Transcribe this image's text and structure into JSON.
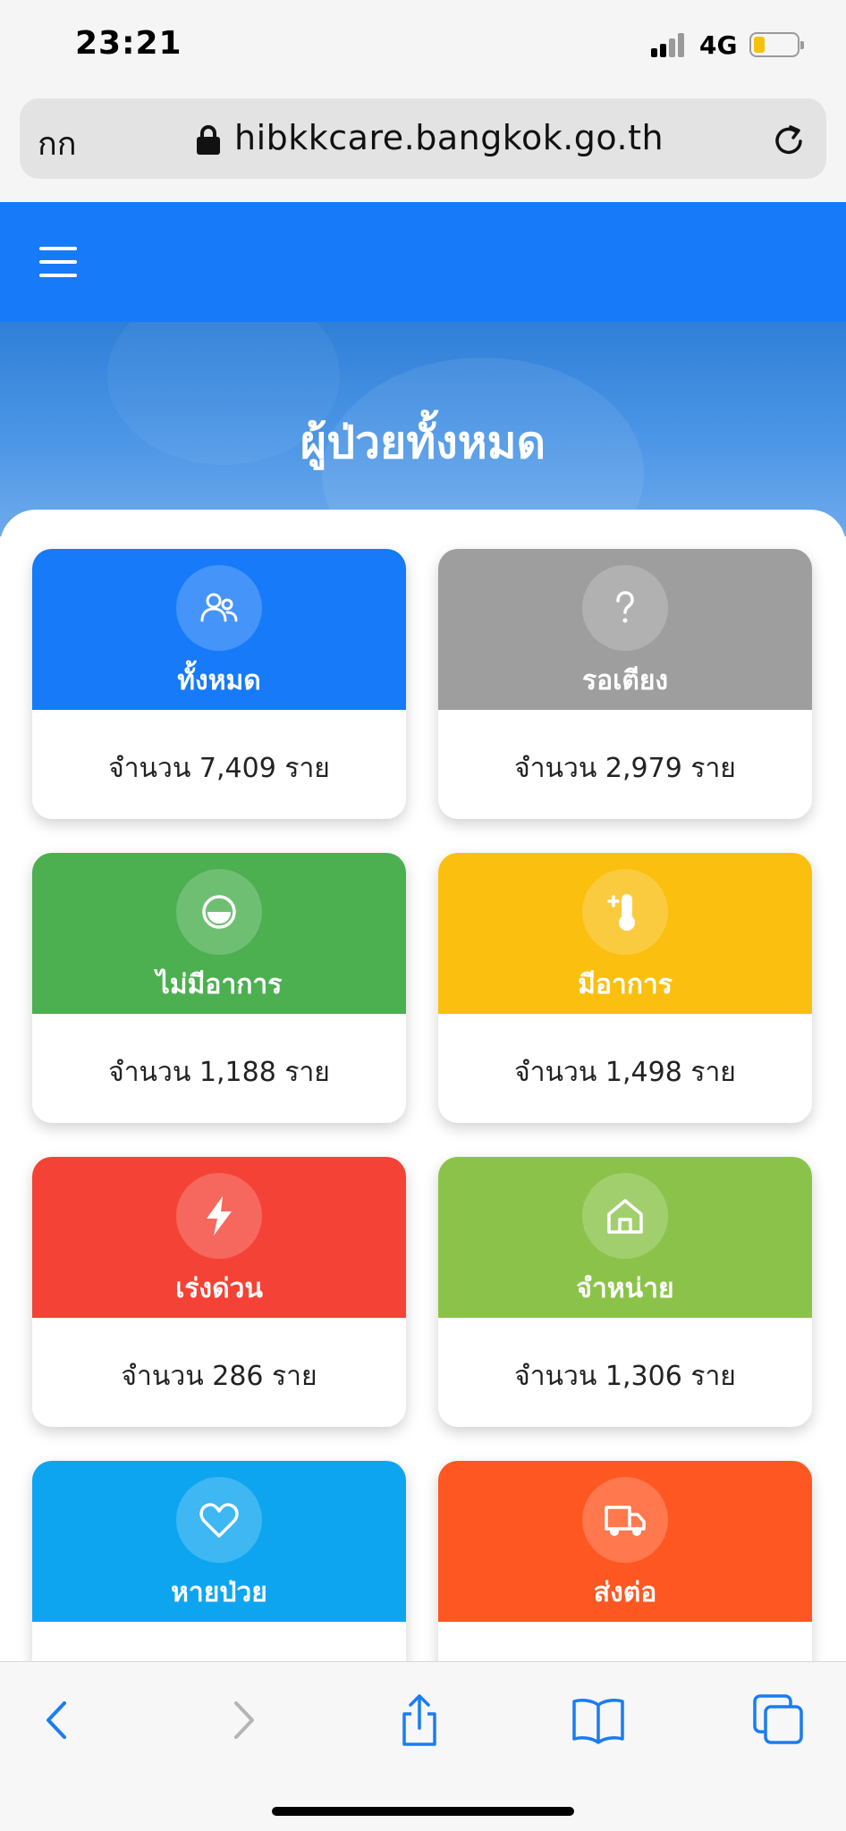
{
  "status_bar": {
    "time": "23:21",
    "network": "4G"
  },
  "address_bar": {
    "text_size_label": "กก",
    "url": "hibkkcare.bangkok.go.th"
  },
  "hero": {
    "title": "ผู้ป่วยทั้งหมด"
  },
  "cards": [
    {
      "label": "ทั้งหมด",
      "count": "จำนวน 7,409 ราย",
      "color": "#167af9",
      "icon": "people-icon"
    },
    {
      "label": "รอเตียง",
      "count": "จำนวน 2,979 ราย",
      "color": "#9e9e9e",
      "icon": "question-icon"
    },
    {
      "label": "ไม่มีอาการ",
      "count": "จำนวน 1,188 ราย",
      "color": "#4caf50",
      "icon": "smile-icon"
    },
    {
      "label": "มีอาการ",
      "count": "จำนวน 1,498 ราย",
      "color": "#fbbf10",
      "icon": "thermometer-icon"
    },
    {
      "label": "เร่งด่วน",
      "count": "จำนวน 286 ราย",
      "color": "#f44336",
      "icon": "lightning-icon"
    },
    {
      "label": "จำหน่าย",
      "count": "จำนวน 1,306 ราย",
      "color": "#8bc34a",
      "icon": "home-icon"
    },
    {
      "label": "หายป่วย",
      "count": "",
      "color": "#0ea5f0",
      "icon": "heart-icon"
    },
    {
      "label": "ส่งต่อ",
      "count": "",
      "color": "#ff5722",
      "icon": "truck-icon"
    }
  ],
  "toolbar": {
    "items": [
      "back-icon",
      "forward-icon",
      "share-icon",
      "bookmarks-icon",
      "tabs-icon"
    ],
    "accent": "#1a7cf4",
    "disabled": "#b5b5b5"
  }
}
